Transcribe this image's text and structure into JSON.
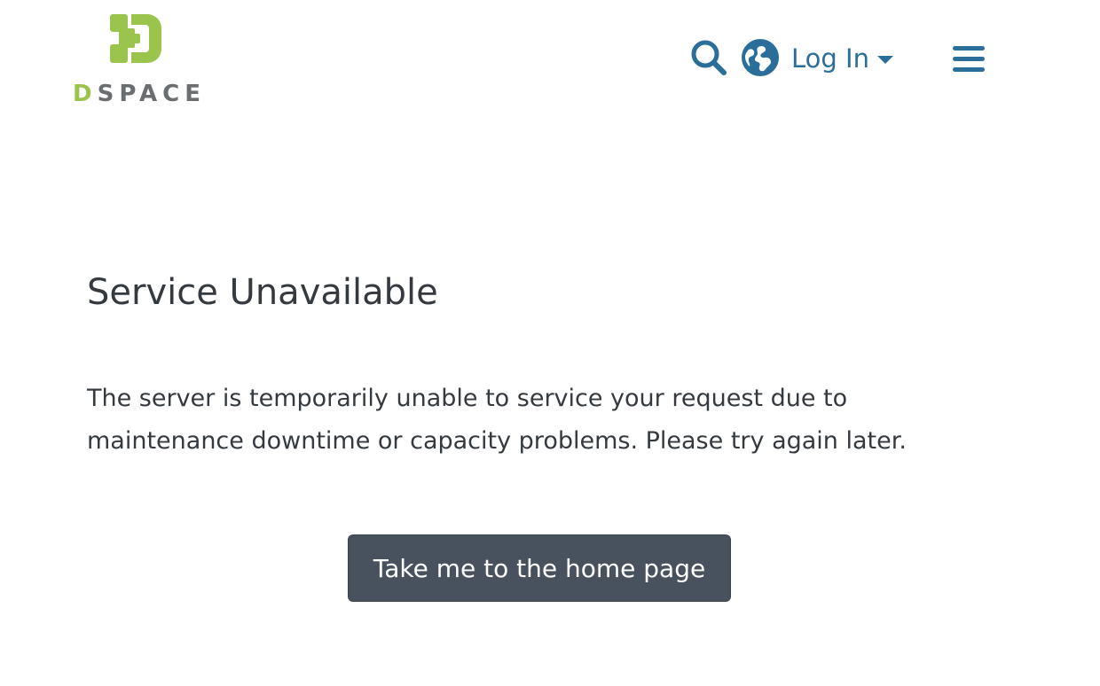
{
  "header": {
    "logo": {
      "wordmark_d": "D",
      "wordmark_rest": "SPACE",
      "icon": "dspace-logo-icon",
      "colors": {
        "green": "#9bc44d",
        "gray": "#6b6e70"
      }
    },
    "search_icon": "search-icon",
    "language_icon": "globe-icon",
    "login_label": "Log In",
    "menu_icon": "hamburger-menu-icon",
    "accent_color": "#2b6e9a"
  },
  "main": {
    "title": "Service Unavailable",
    "message": "The server is temporarily unable to service your request due to maintenance downtime or capacity problems. Please try again later.",
    "home_button_label": "Take me to the home page",
    "button_color": "#47525e",
    "text_color": "#343a40"
  }
}
